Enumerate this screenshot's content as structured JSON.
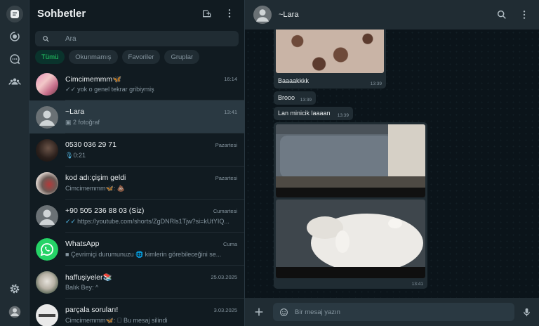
{
  "sidebar_title": "Sohbetler",
  "search": {
    "placeholder": "Ara"
  },
  "filters": [
    "Tümü",
    "Okunmamış",
    "Favoriler",
    "Gruplar"
  ],
  "active_filter": 0,
  "chats": [
    {
      "name": "Cimcimemmm🦋",
      "time": "16:14",
      "preview": "yok o genel tekrar gribiymiş",
      "tick": "✓✓"
    },
    {
      "name": "~Lara",
      "time": "13:41",
      "preview": "2 fotoğraf",
      "tick": "",
      "selected": true
    },
    {
      "name": "0530 036 29 71",
      "time": "Pazartesi",
      "preview": "0:21",
      "tick": ""
    },
    {
      "name": "kod adı:çişim geldi",
      "time": "Pazartesi",
      "preview": "Cimcimemmm🦋: 💩",
      "tick": ""
    },
    {
      "name": "+90 505 236 88 03 (Siz)",
      "time": "Cumartesi",
      "preview": "https://youtube.com/shorts/ZgDNRls1Tjw?si=kUtYIQ...",
      "tick": "✓✓"
    },
    {
      "name": "WhatsApp",
      "time": "Cuma",
      "preview": "Çevrimiçi durumunuzu 🌐 kimlerin görebileceğini se...",
      "tick": ""
    },
    {
      "name": "haffuşiyeler📚",
      "time": "25.03.2025",
      "preview": "Balık Bey: ^",
      "tick": ""
    },
    {
      "name": "parçala soruları!",
      "time": "3.03.2025",
      "preview": "Cimcimemmm🦋: ⃠ Bu mesaj silindi",
      "tick": ""
    }
  ],
  "conversation": {
    "contact": "~Lara",
    "messages": [
      {
        "text": "Baaaakkkk",
        "time": "13:39"
      },
      {
        "text": "Brooo",
        "time": "13:39"
      },
      {
        "text": "Lan minicik laaaan",
        "time": "13:39"
      }
    ],
    "album_time": "13:41",
    "composer_placeholder": "Bir mesaj yazın"
  },
  "colors": {
    "accent": "#25d366",
    "panel": "#202c33",
    "background": "#111b21"
  }
}
